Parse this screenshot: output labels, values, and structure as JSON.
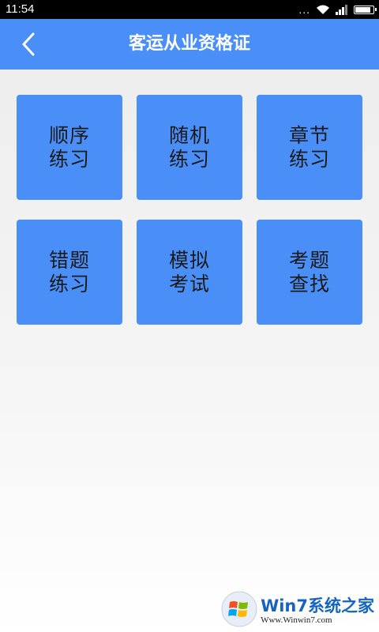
{
  "status_bar": {
    "time": "11:54",
    "dots": "...",
    "icons": [
      "wifi-icon",
      "signal-icon",
      "battery-icon"
    ]
  },
  "header": {
    "title": "客运从业资格证",
    "back_icon": "chevron-left-icon",
    "color": "#4a8ff7"
  },
  "tiles": [
    {
      "label": "顺序练习"
    },
    {
      "label": "随机练习"
    },
    {
      "label": "章节练习"
    },
    {
      "label": "错题练习"
    },
    {
      "label": "模拟考试"
    },
    {
      "label": "考题查找"
    }
  ],
  "watermark": {
    "brand": "Win7系统之家",
    "url": "Www.Winwin7.com"
  }
}
